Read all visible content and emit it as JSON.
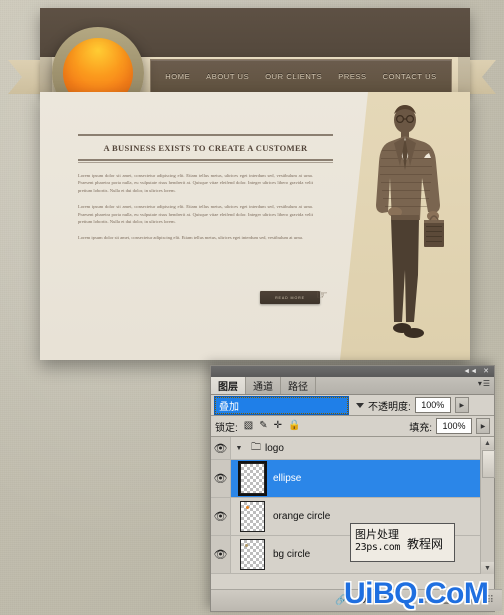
{
  "website": {
    "nav_items": [
      "HOME",
      "ABOUT US",
      "OUR CLIENTS",
      "PRESS",
      "CONTACT US"
    ],
    "headline": "A BUSINESS EXISTS TO CREATE A CUSTOMER",
    "paragraphs": [
      "Lorem ipsum dolor sit amet, consectetur adipiscing elit. Etiam tellus metus, ultrices eget interdum sed, vestibulum at urna. Praesent pharetra porta nulla, eu vulputate risus hendrerit at. Quisque vitae eleifend dolor. Integer ultrices libero gravida velit pretium lobortis. Nulla et dui dolor, in ultrices lorem.",
      "Lorem ipsum dolor sit amet, consectetur adipiscing elit. Etiam tellus metus, ultrices eget interdum sed, vestibulum at urna. Praesent pharetra porta nulla, eu vulputate risus hendrerit at. Quisque vitae eleifend dolor. Integer ultrices libero gravida velit pretium lobortis. Nulla et dui dolor, in ultrices lorem.",
      "Lorem ipsum dolor sit amet, consectetur adipiscing elit. Etiam tellus metus, ultrices eget interdum sed, vestibulum at urna."
    ],
    "cta_label": "READ MORE",
    "colors": {
      "band": "#564a3e",
      "ribbon": "#dfd2b4",
      "logo_orange": "#f7821a",
      "page": "#ece7dc"
    }
  },
  "photoshop": {
    "titlebar": {
      "collapse": "◄◄",
      "close": "✕"
    },
    "tabs": [
      {
        "label": "图层",
        "active": true
      },
      {
        "label": "通道",
        "active": false
      },
      {
        "label": "路径",
        "active": false
      }
    ],
    "menu_icon": "panel-menu-icon",
    "blend_mode": "叠加",
    "opacity_label": "不透明度:",
    "opacity_value": "100%",
    "lock_label": "锁定:",
    "lock_icons": [
      "transparency-lock-icon",
      "brush-lock-icon",
      "move-lock-icon",
      "all-lock-icon"
    ],
    "fill_label": "填充:",
    "fill_value": "100%",
    "layers": [
      {
        "name": "logo",
        "type": "group",
        "visible": true,
        "selected": false
      },
      {
        "name": "ellipse",
        "type": "layer",
        "visible": true,
        "selected": true,
        "dot": ""
      },
      {
        "name": "orange circle",
        "type": "layer",
        "visible": true,
        "selected": false,
        "dot": "#e8821e"
      },
      {
        "name": "bg circle",
        "type": "layer",
        "visible": true,
        "selected": false,
        "dot": "#b09a6a"
      }
    ],
    "bottom_icons": [
      "link-icon",
      "fx-icon",
      "mask-icon",
      "adjustment-icon",
      "group-icon",
      "new-layer-icon",
      "delete-icon"
    ],
    "selection_color": "#2b86e8"
  },
  "watermarks": {
    "box": {
      "line1": "图片处理",
      "line2": "23ps.com",
      "line3": "教程网"
    },
    "big": "UiBQ.CoM"
  }
}
